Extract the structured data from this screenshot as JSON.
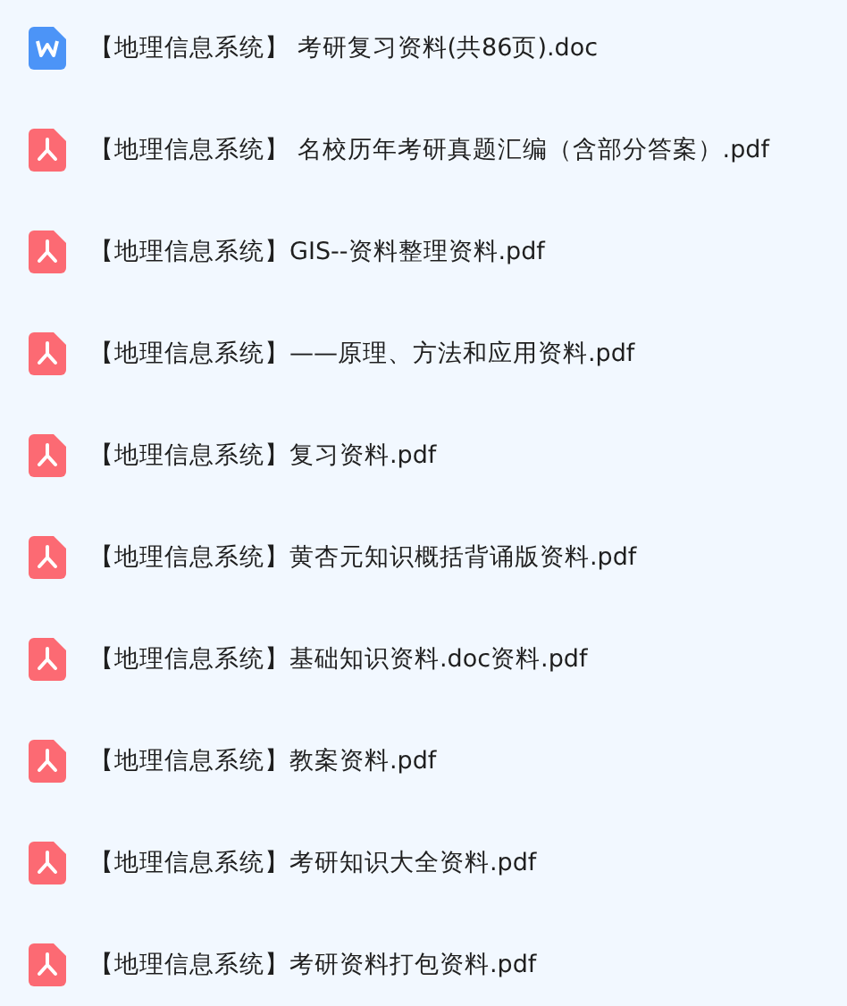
{
  "files": [
    {
      "kind": "doc",
      "name": "【地理信息系统】 考研复习资料(共86页).doc"
    },
    {
      "kind": "pdf",
      "name": "【地理信息系统】 名校历年考研真题汇编（含部分答案）.pdf"
    },
    {
      "kind": "pdf",
      "name": "【地理信息系统】GIS--资料整理资料.pdf"
    },
    {
      "kind": "pdf",
      "name": "【地理信息系统】——原理、方法和应用资料.pdf"
    },
    {
      "kind": "pdf",
      "name": "【地理信息系统】复习资料.pdf"
    },
    {
      "kind": "pdf",
      "name": "【地理信息系统】黄杏元知识概括背诵版资料.pdf"
    },
    {
      "kind": "pdf",
      "name": "【地理信息系统】基础知识资料.doc资料.pdf"
    },
    {
      "kind": "pdf",
      "name": "【地理信息系统】教案资料.pdf"
    },
    {
      "kind": "pdf",
      "name": "【地理信息系统】考研知识大全资料.pdf"
    },
    {
      "kind": "pdf",
      "name": "【地理信息系统】考研资料打包资料.pdf"
    }
  ]
}
